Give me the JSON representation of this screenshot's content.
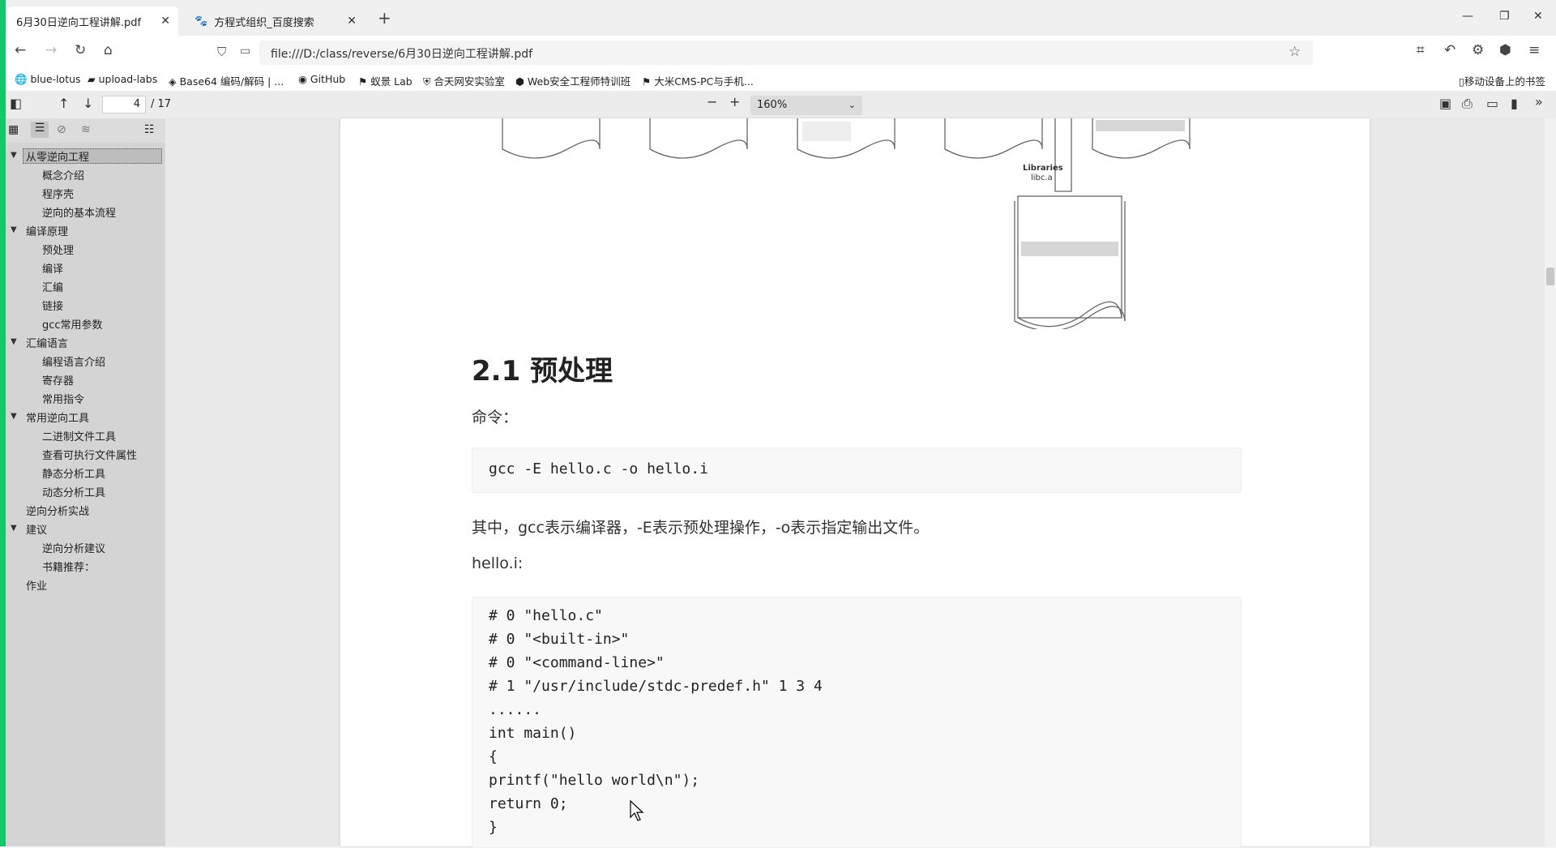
{
  "tabs": [
    {
      "title": "6月30日逆向工程讲解.pdf",
      "active": true
    },
    {
      "title": "方程式组织_百度搜索",
      "active": false
    }
  ],
  "address": {
    "url": "file:///D:/class/reverse/6月30日逆向工程讲解.pdf"
  },
  "bookmarks": [
    {
      "label": "blue-lotus"
    },
    {
      "label": "upload-labs"
    },
    {
      "label": "Base64 编码/解码 | ..."
    },
    {
      "label": "GitHub"
    },
    {
      "label": "蚁景 Lab"
    },
    {
      "label": "合天网安实验室"
    },
    {
      "label": "Web安全工程师特训班"
    },
    {
      "label": "大米CMS-PC与手机..."
    },
    {
      "label": "移动设备上的书签"
    }
  ],
  "pdf_toolbar": {
    "page_current": "4",
    "page_total": "/ 17",
    "zoom": "160%"
  },
  "outline": [
    {
      "label": "从零逆向工程",
      "level": 0,
      "expanded": true,
      "selected": true
    },
    {
      "label": "概念介绍",
      "level": 1
    },
    {
      "label": "程序壳",
      "level": 1
    },
    {
      "label": "逆向的基本流程",
      "level": 1
    },
    {
      "label": "编译原理",
      "level": 0,
      "expanded": true
    },
    {
      "label": "预处理",
      "level": 1
    },
    {
      "label": "编译",
      "level": 1
    },
    {
      "label": "汇编",
      "level": 1
    },
    {
      "label": "链接",
      "level": 1
    },
    {
      "label": "gcc常用参数",
      "level": 1
    },
    {
      "label": "汇编语言",
      "level": 0,
      "expanded": true
    },
    {
      "label": "编程语言介绍",
      "level": 1
    },
    {
      "label": "寄存器",
      "level": 1
    },
    {
      "label": "常用指令",
      "level": 1
    },
    {
      "label": "常用逆向工具",
      "level": 0,
      "expanded": true
    },
    {
      "label": "二进制文件工具",
      "level": 1
    },
    {
      "label": "查看可执行文件属性",
      "level": 1
    },
    {
      "label": "静态分析工具",
      "level": 1
    },
    {
      "label": "动态分析工具",
      "level": 1
    },
    {
      "label": "逆向分析实战",
      "level": 0
    },
    {
      "label": "建议",
      "level": 0,
      "expanded": true
    },
    {
      "label": "逆向分析建议",
      "level": 1
    },
    {
      "label": "书籍推荐：",
      "level": 1
    },
    {
      "label": "作业",
      "level": 0
    }
  ],
  "document": {
    "diagram_label_line1": "Libraries",
    "diagram_label_line2": "libc.a",
    "heading": "2.1 预处理",
    "command_label": "命令：",
    "command": "gcc -E hello.c -o hello.i",
    "explanation": "其中，gcc表示编译器，-E表示预处理操作，-o表示指定输出文件。",
    "file_label": "hello.i:",
    "code_lines": [
      "# 0 \"hello.c\"",
      "# 0 \"<built-in>\"",
      "# 0 \"<command-line>\"",
      "# 1 \"/usr/include/stdc-predef.h\" 1 3 4",
      "......",
      "int main()",
      "{",
      "printf(\"hello world\\n\");",
      "return 0;",
      "}"
    ]
  },
  "colors": {
    "accent": "#15c76b",
    "sidebar_bg": "#d4d4d4",
    "page_bg": "#ffffff"
  }
}
